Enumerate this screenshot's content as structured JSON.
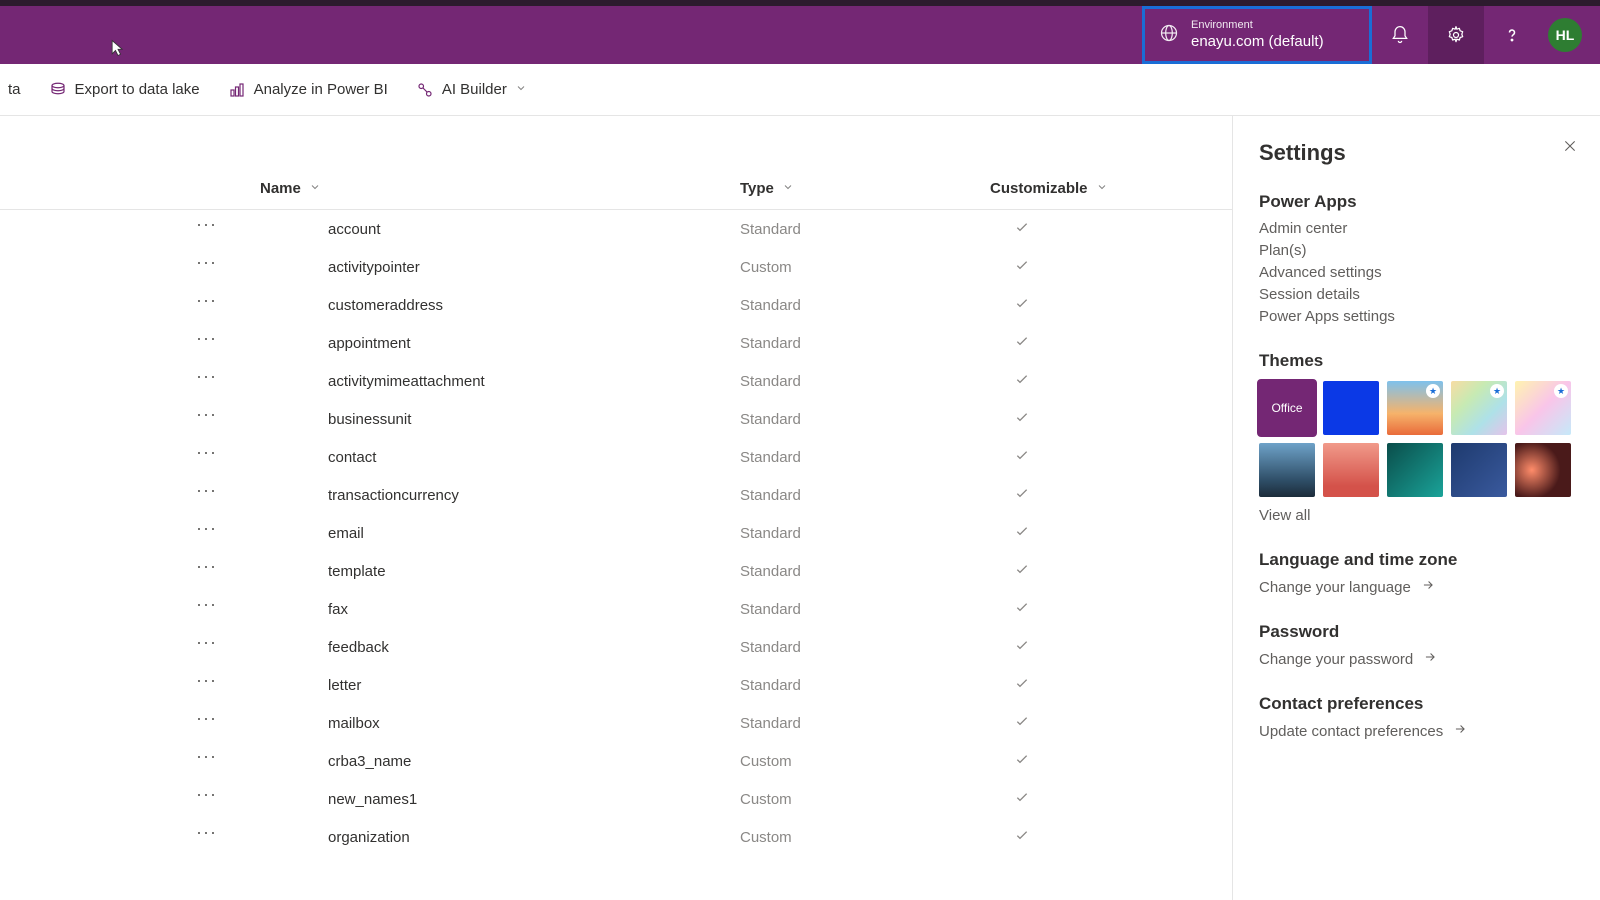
{
  "header": {
    "environment_label": "Environment",
    "environment_value": "enayu.com (default)",
    "avatar_initials": "HL"
  },
  "toolbar": {
    "data_tail": "ta",
    "export_lake": "Export to data lake",
    "analyze_powerbi": "Analyze in Power BI",
    "ai_builder": "AI Builder"
  },
  "table": {
    "columns": {
      "name": "Name",
      "type": "Type",
      "customizable": "Customizable"
    },
    "rows": [
      {
        "name": "account",
        "type": "Standard"
      },
      {
        "name": "activitypointer",
        "type": "Custom"
      },
      {
        "name": "customeraddress",
        "type": "Standard"
      },
      {
        "name": "appointment",
        "type": "Standard"
      },
      {
        "name": "activitymimeattachment",
        "type": "Standard"
      },
      {
        "name": "businessunit",
        "type": "Standard"
      },
      {
        "name": "contact",
        "type": "Standard"
      },
      {
        "name": "transactioncurrency",
        "type": "Standard"
      },
      {
        "name": "email",
        "type": "Standard"
      },
      {
        "name": "template",
        "type": "Standard"
      },
      {
        "name": "fax",
        "type": "Standard"
      },
      {
        "name": "feedback",
        "type": "Standard"
      },
      {
        "name": "letter",
        "type": "Standard"
      },
      {
        "name": "mailbox",
        "type": "Standard"
      },
      {
        "name": "crba3_name",
        "type": "Custom"
      },
      {
        "name": "new_names1",
        "type": "Custom"
      },
      {
        "name": "organization",
        "type": "Custom"
      }
    ]
  },
  "settings": {
    "title": "Settings",
    "powerapps_heading": "Power Apps",
    "links": {
      "admin_center": "Admin center",
      "plans": "Plan(s)",
      "advanced": "Advanced settings",
      "session": "Session details",
      "pa_settings": "Power Apps settings"
    },
    "themes_heading": "Themes",
    "theme_office_label": "Office",
    "view_all": "View all",
    "language_heading": "Language and time zone",
    "change_language": "Change your language",
    "password_heading": "Password",
    "change_password": "Change your password",
    "contact_heading": "Contact preferences",
    "update_contact": "Update contact preferences"
  }
}
